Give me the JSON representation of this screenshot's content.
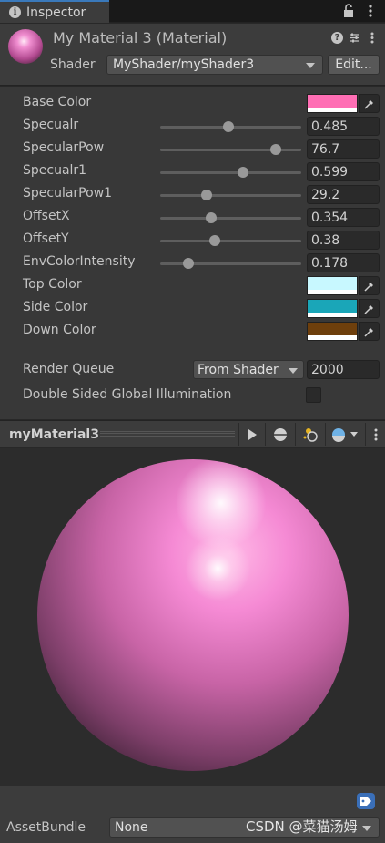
{
  "tab": {
    "label": "Inspector",
    "icon": "info-icon"
  },
  "header": {
    "title": "My Material 3 (Material)",
    "shader_label": "Shader",
    "shader_value": "MyShader/myShader3",
    "edit_label": "Edit..."
  },
  "properties": {
    "base_color": {
      "label": "Base Color",
      "color": "#ff6eb4"
    },
    "specualr": {
      "label": "Specualr",
      "value": "0.485",
      "fraction": 0.485
    },
    "specular_pow": {
      "label": "SpecularPow",
      "value": "76.7",
      "fraction": 0.82
    },
    "specualr1": {
      "label": "Specualr1",
      "value": "0.599",
      "fraction": 0.585
    },
    "specular_pow1": {
      "label": "SpecularPow1",
      "value": "29.2",
      "fraction": 0.33
    },
    "offset_x": {
      "label": "OffsetX",
      "value": "0.354",
      "fraction": 0.36
    },
    "offset_y": {
      "label": "OffsetY",
      "value": "0.38",
      "fraction": 0.39
    },
    "env_color_intensity": {
      "label": "EnvColorIntensity",
      "value": "0.178",
      "fraction": 0.2
    },
    "top_color": {
      "label": "Top Color",
      "color": "#c8f8ff"
    },
    "side_color": {
      "label": "Side Color",
      "color": "#1aa6b8"
    },
    "down_color": {
      "label": "Down Color",
      "color": "#6e3f0c"
    },
    "render_queue": {
      "label": "Render Queue",
      "dropdown": "From Shader",
      "value": "2000"
    },
    "double_sided_gi": {
      "label": "Double Sided Global Illumination",
      "checked": false
    }
  },
  "preview": {
    "title": "myMaterial3"
  },
  "asset_bundle": {
    "label": "AssetBundle",
    "value": "None"
  },
  "watermark": "CSDN @菜猫汤姆"
}
